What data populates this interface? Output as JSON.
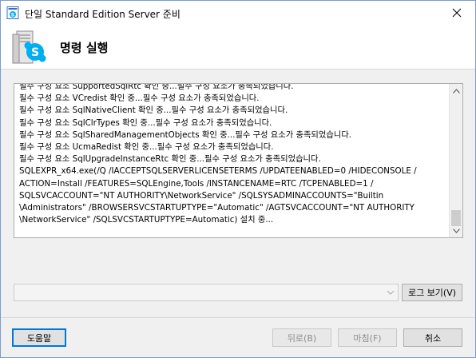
{
  "window": {
    "title": "단일 Standard Edition Server 준비"
  },
  "header": {
    "title": "명령 실행"
  },
  "log": {
    "lines": [
      "필수 구성 요소 SupportedSqlRtc 확인 중...필수 구성 요소가 충족되었습니다.",
      "필수 구성 요소 VCredist 확인 중...필수 구성 요소가 충족되었습니다.",
      "필수 구성 요소 SqlNativeClient 확인 중...필수 구성 요소가 충족되었습니다.",
      "필수 구성 요소 SqlClrTypes 확인 중...필수 구성 요소가 충족되었습니다.",
      "필수 구성 요소 SqlSharedManagementObjects 확인 중...필수 구성 요소가 충족되었습니다.",
      "필수 구성 요소 UcmaRedist 확인 중...필수 구성 요소가 충족되었습니다.",
      "필수 구성 요소 SqlUpgradeInstanceRtc 확인 중...필수 구성 요소가 충족되었습니다.",
      "SQLEXPR_x64.exe(/Q /IACCEPTSQLSERVERLICENSETERMS /UPDATEENABLED=0 /HIDECONSOLE /",
      "ACTION=Install /FEATURES=SQLEngine,Tools /INSTANCENAME=RTC /TCPENABLED=1 /",
      "SQLSVCACCOUNT=\"NT AUTHORITY\\NetworkService\" /SQLSYSADMINACCOUNTS=\"Builtin",
      "\\Administrators\" /BROWSERSVCSTARTUPTYPE=\"Automatic\" /AGTSVCACCOUNT=\"NT AUTHORITY",
      "\\NetworkService\" /SQLSVCSTARTUPTYPE=Automatic) 설치 중..."
    ]
  },
  "buttons": {
    "view_log": "로그 보기(V)",
    "help": "도움말",
    "back": "뒤로(B)",
    "finish": "마침(F)",
    "cancel": "취소"
  },
  "icons": {
    "app": "skype-server-app-icon",
    "header": "skype-server-deploy-icon",
    "close": "close-icon"
  },
  "colors": {
    "skype_blue": "#00aff0",
    "default_button_border": "#0078d7"
  }
}
